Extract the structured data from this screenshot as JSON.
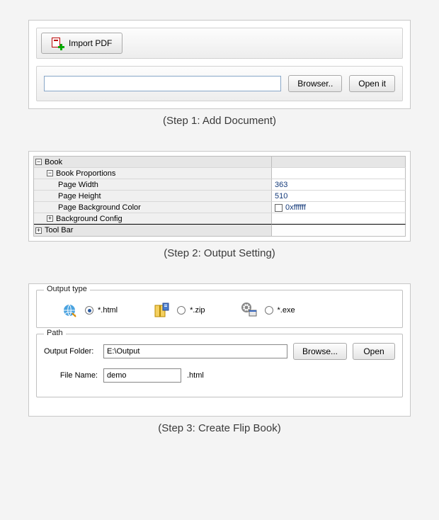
{
  "step1": {
    "import_label": "Import PDF",
    "browser_label": "Browser..",
    "open_label": "Open it",
    "path_value": "",
    "caption": "(Step 1: Add Document)"
  },
  "step2": {
    "rows": {
      "book": "Book",
      "proportions": "Book Proportions",
      "page_width_label": "Page Width",
      "page_width_value": "363",
      "page_height_label": "Page Height",
      "page_height_value": "510",
      "page_bg_label": "Page Background Color",
      "page_bg_value": "0xffffff",
      "bg_config": "Background Config",
      "toolbar": "Tool Bar"
    },
    "caption": "(Step 2: Output Setting)"
  },
  "step3": {
    "output_type_legend": "Output type",
    "types": {
      "html": "*.html",
      "zip": "*.zip",
      "exe": "*.exe"
    },
    "path_legend": "Path",
    "output_folder_label": "Output Folder:",
    "output_folder_value": "E:\\Output",
    "browse_label": "Browse...",
    "open_label": "Open",
    "file_name_label": "File Name:",
    "file_name_value": "demo",
    "file_ext": ".html",
    "caption": "(Step 3: Create Flip Book)"
  }
}
